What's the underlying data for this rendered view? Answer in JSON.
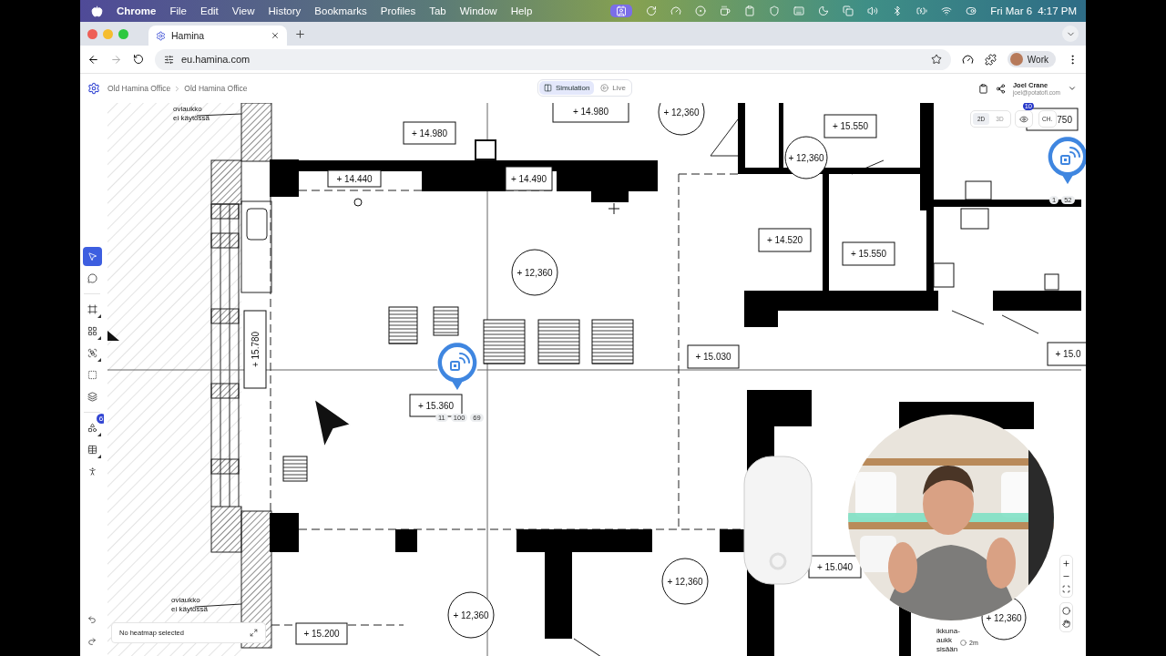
{
  "menu_bar": {
    "app": "Chrome",
    "menus": [
      "File",
      "Edit",
      "View",
      "History",
      "Bookmarks",
      "Profiles",
      "Tab",
      "Window",
      "Help"
    ],
    "date": "Fri Mar 6",
    "time": "4:17 PM"
  },
  "browser": {
    "tabs": [
      {
        "title": "Hamina",
        "selected": true
      }
    ],
    "url": "eu.hamina.com",
    "profile": "Work"
  },
  "header": {
    "breadcrumb": [
      "Old Hamina Office",
      "Old Hamina Office"
    ],
    "modes": [
      {
        "label": "Simulation",
        "selected": true
      },
      {
        "label": "Live",
        "selected": false
      }
    ],
    "user": {
      "name": "Joel Crane",
      "email": "joel@potatofi.com"
    }
  },
  "tools": [
    {
      "selected": true,
      "submenu": false
    },
    {
      "selected": false,
      "submenu": false
    },
    {
      "selected": false,
      "submenu": true
    },
    {
      "selected": false,
      "submenu": true
    },
    {
      "selected": false,
      "submenu": true
    },
    {
      "selected": false,
      "submenu": false
    },
    {
      "selected": false,
      "submenu": false
    },
    {
      "selected": false,
      "submenu": true,
      "badge": "6"
    },
    {
      "selected": false,
      "submenu": true
    },
    {
      "selected": false,
      "submenu": false
    }
  ],
  "view_toggle": [
    {
      "label": "2D",
      "selected": true
    },
    {
      "label": "3D",
      "selected": false
    }
  ],
  "visibility_badge": "10",
  "channel_button": "CH.",
  "floor_plan": {
    "notes": [
      [
        "oviaukko",
        "ei käytössä"
      ],
      [
        "oviaukko",
        "ei käytössä"
      ],
      [
        "ikkuna-",
        "aukk",
        "sisään"
      ]
    ],
    "elevations": [
      "+ 14.980",
      "+ 14.980",
      "+ 14.440",
      "+ 14.490",
      "+ 15.550",
      "+ 14.520",
      "+ 15.550",
      "+ 15.780",
      "+ 15.030",
      "+ 15.0",
      "+ 15.360",
      "+ 15.040",
      "+ 15.200",
      "750"
    ],
    "ceiling_heights": [
      "+ 12,360",
      "+ 12,360",
      "+ 12,360",
      "+ 12,360",
      "+ 12,360",
      "+ 12,360"
    ]
  },
  "access_points": [
    {
      "chips": [
        "11",
        "100",
        "69"
      ]
    },
    {
      "chips": [
        "1",
        "52"
      ]
    }
  ],
  "heatmap": {
    "label": "No heatmap selected"
  },
  "scale": "2m"
}
